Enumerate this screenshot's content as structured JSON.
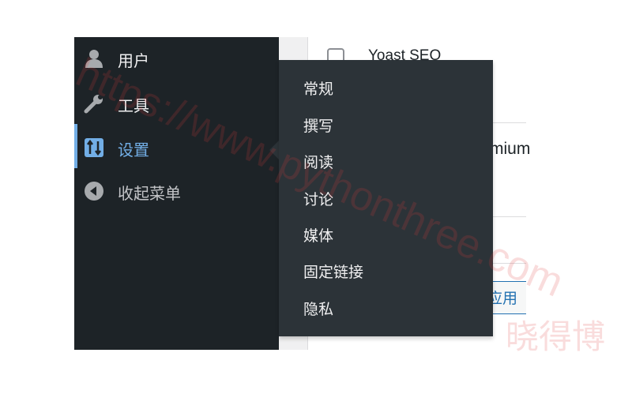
{
  "sidebar": {
    "items": [
      {
        "label": "用户",
        "icon": "user-icon"
      },
      {
        "label": "工具",
        "icon": "wrench-icon"
      },
      {
        "label": "设置",
        "icon": "settings-icon"
      },
      {
        "label": "收起菜单",
        "icon": "collapse-icon"
      }
    ],
    "current_color": "#72aee6",
    "background": "#1d2327"
  },
  "settings_submenu": {
    "items": [
      "常规",
      "撰写",
      "阅读",
      "讨论",
      "媒体",
      "固定链接",
      "隐私"
    ],
    "background": "#2c3338"
  },
  "plugins": {
    "rows": [
      "Yoast SEO",
      "mium"
    ],
    "apply_label": "应用"
  },
  "watermark": {
    "text": "https://www.pythonthree.com",
    "text_cn": "晓得博"
  }
}
